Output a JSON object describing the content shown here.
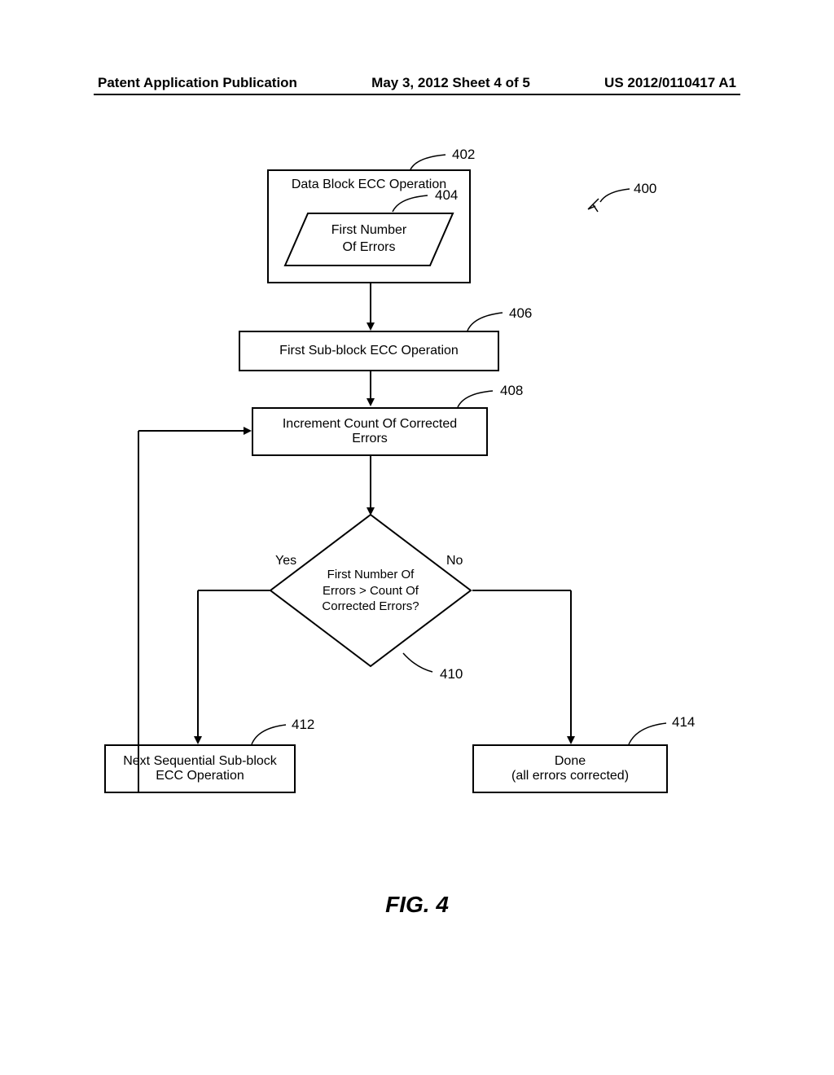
{
  "header": {
    "left": "Patent Application Publication",
    "center": "May 3, 2012  Sheet 4 of 5",
    "right": "US 2012/0110417 A1"
  },
  "callouts": {
    "c400": "400",
    "c402": "402",
    "c404": "404",
    "c406": "406",
    "c408": "408",
    "c410": "410",
    "c412": "412",
    "c414": "414"
  },
  "boxes": {
    "block402_title": "Data Block ECC Operation",
    "block404_line1": "First Number",
    "block404_line2": "Of Errors",
    "block406": "First Sub-block ECC Operation",
    "block408_line1": "Increment Count Of Corrected",
    "block408_line2": "Errors",
    "block410_line1": "First Number Of",
    "block410_line2": "Errors > Count Of",
    "block410_line3": "Corrected Errors?",
    "block412_line1": "Next Sequential Sub-block",
    "block412_line2": "ECC Operation",
    "block414_line1": "Done",
    "block414_line2": "(all errors corrected)"
  },
  "labels": {
    "yes": "Yes",
    "no": "No"
  },
  "figure": "FIG. 4"
}
